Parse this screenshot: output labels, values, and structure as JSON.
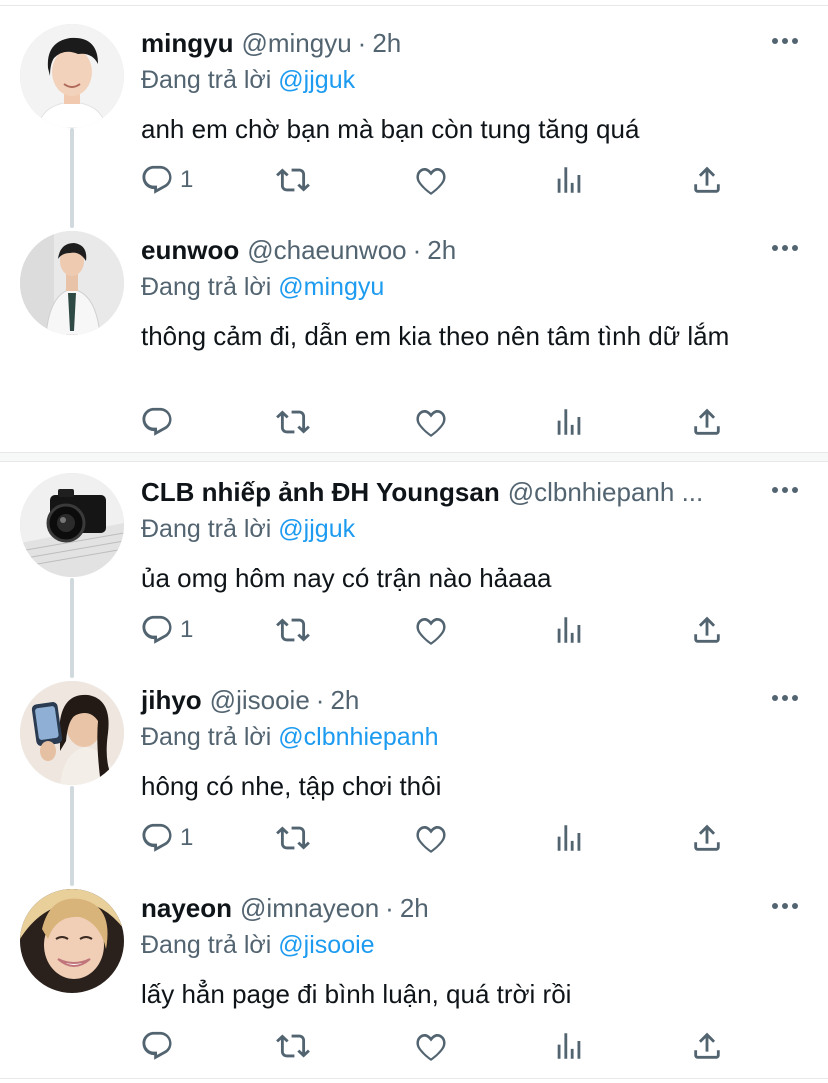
{
  "replying_prefix": "Đang trả lời",
  "colors": {
    "accent": "#1d9bf0",
    "muted": "#536471",
    "text": "#0f1419",
    "thread_line": "#cfd9de"
  },
  "icons": {
    "reply": "reply-icon",
    "retweet": "retweet-icon",
    "like": "heart-icon",
    "stats": "stats-icon",
    "share": "share-icon",
    "more": "more-icon"
  },
  "tweets": [
    {
      "name": "mingyu",
      "handle": "@mingyu",
      "sep": "·",
      "time": "2h",
      "reply_to": "@jjguk",
      "text": "anh em chờ bạn mà bạn còn tung tăng quá",
      "reply_count": "1"
    },
    {
      "name": "eunwoo",
      "handle": "@chaeunwoo",
      "sep": "·",
      "time": "2h",
      "reply_to": "@mingyu",
      "text": "thông cảm đi, dẫn em kia theo nên tâm tình dữ lắm",
      "reply_count": ""
    },
    {
      "name": "CLB nhiếp ảnh ĐH Youngsan",
      "handle": "@clbnhiepanh ...",
      "sep": "",
      "time": "",
      "reply_to": "@jjguk",
      "text": "ủa omg hôm nay có trận nào hảaaa",
      "reply_count": "1"
    },
    {
      "name": "jihyo",
      "handle": "@jisooie",
      "sep": "·",
      "time": "2h",
      "reply_to": "@clbnhiepanh",
      "text": "hông có nhe, tập chơi thôi",
      "reply_count": "1"
    },
    {
      "name": "nayeon",
      "handle": "@imnayeon",
      "sep": "·",
      "time": "2h",
      "reply_to": "@jisooie",
      "text": "lấy hẳn page đi bình luận, quá trời rồi",
      "reply_count": ""
    }
  ]
}
